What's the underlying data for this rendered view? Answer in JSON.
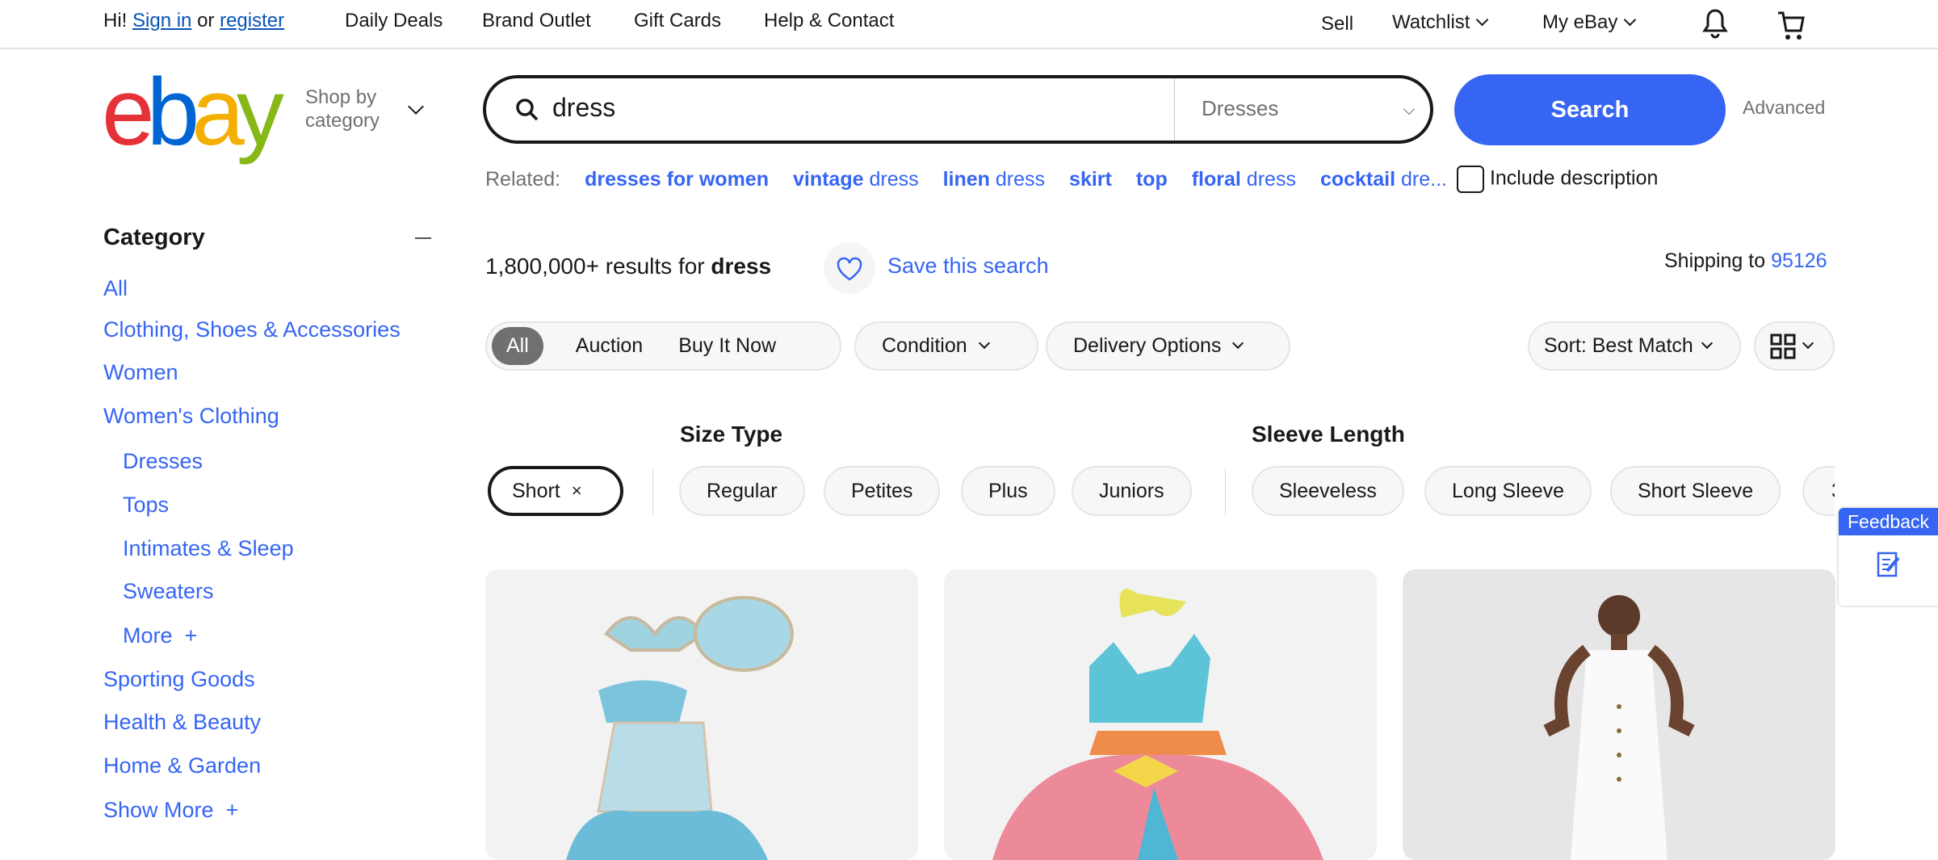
{
  "topnav": {
    "greeting": "Hi!",
    "sign_in": "Sign in",
    "or": "or",
    "register": "register",
    "links": [
      "Daily Deals",
      "Brand Outlet",
      "Gift Cards",
      "Help & Contact"
    ],
    "sell": "Sell",
    "watchlist": "Watchlist",
    "my_ebay": "My eBay"
  },
  "header": {
    "logo": "ebay",
    "shop_by": "Shop by",
    "category": "category",
    "search_value": "dress",
    "category_select": "Dresses",
    "search_button": "Search",
    "advanced": "Advanced"
  },
  "related": {
    "label": "Related:",
    "links": [
      {
        "bold": "dresses for women",
        "rest": ""
      },
      {
        "bold": "vintage",
        "rest": " dress"
      },
      {
        "bold": "linen",
        "rest": " dress"
      },
      {
        "bold": "skirt",
        "rest": ""
      },
      {
        "bold": "top",
        "rest": ""
      },
      {
        "bold": "floral",
        "rest": " dress"
      },
      {
        "bold": "cocktail",
        "rest": " dre..."
      }
    ],
    "include_description": "Include description"
  },
  "sidebar": {
    "heading": "Category",
    "items": [
      "All",
      "Clothing, Shoes & Accessories",
      "Women",
      "Women's Clothing",
      "Dresses",
      "Tops",
      "Intimates & Sleep",
      "Sweaters",
      "More",
      "Sporting Goods",
      "Health & Beauty",
      "Home & Garden",
      "Show More"
    ]
  },
  "results": {
    "count": "1,800,000+",
    "text": " results for ",
    "query": "dress",
    "save_search": "Save this search",
    "shipping_to": "Shipping to",
    "zip": "95126"
  },
  "filters": {
    "buying_format": [
      "All",
      "Auction",
      "Buy It Now"
    ],
    "condition": "Condition",
    "delivery": "Delivery Options",
    "sort": "Sort: Best Match"
  },
  "aspects": {
    "active_chip": "Short",
    "size_type_heading": "Size Type",
    "size_type": [
      "Regular",
      "Petites",
      "Plus",
      "Juniors"
    ],
    "sleeve_heading": "Sleeve Length",
    "sleeve": [
      "Sleeveless",
      "Long Sleeve",
      "Short Sleeve",
      "3"
    ]
  },
  "feedback": {
    "label": "Feedback"
  },
  "colors": {
    "accent": "#3665f3",
    "logo_e": "#e53238",
    "logo_b": "#0064d2",
    "logo_a": "#f5af02",
    "logo_y": "#86b817"
  }
}
